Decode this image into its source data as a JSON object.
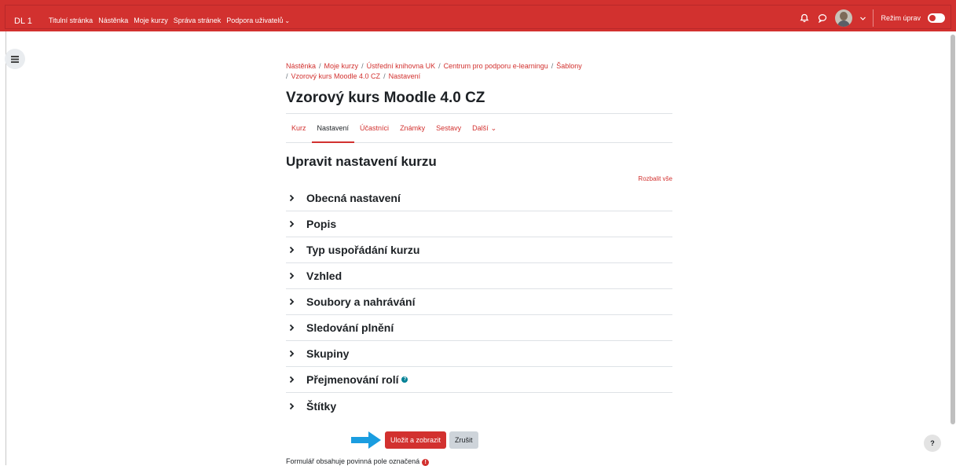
{
  "topbar": {
    "brand": "DL 1",
    "nav": [
      "Titulní stránka",
      "Nástěnka",
      "Moje kurzy",
      "Správa stránek",
      "Podpora uživatelů"
    ],
    "edit_mode_label": "Režim úprav",
    "icons": [
      "bell-icon",
      "chat-icon",
      "user-avatar",
      "chevron-down-icon",
      "toggle-switch"
    ]
  },
  "breadcrumb": [
    "Nástěnka",
    "Moje kurzy",
    "Ústřední knihovna UK",
    "Centrum pro podporu e-learningu",
    "Šablony",
    "Vzorový kurs Moodle 4.0 CZ",
    "Nastavení"
  ],
  "page_title": "Vzorový kurs Moodle 4.0 CZ",
  "tabs": [
    {
      "label": "Kurz"
    },
    {
      "label": "Nastavení",
      "active": true
    },
    {
      "label": "Účastníci"
    },
    {
      "label": "Známky"
    },
    {
      "label": "Sestavy"
    },
    {
      "label": "Další"
    }
  ],
  "section_title": "Upravit nastavení kurzu",
  "expand_all": "Rozbalit vše",
  "fieldsets": [
    "Obecná nastavení",
    "Popis",
    "Typ uspořádání kurzu",
    "Vzhled",
    "Soubory a nahrávání",
    "Sledování plnění",
    "Skupiny",
    "Přejmenování rolí",
    "Štítky"
  ],
  "buttons": {
    "save": "Uložit a zobrazit",
    "cancel": "Zrušit"
  },
  "required_note": "Formulář obsahuje povinná pole označená",
  "help_fab": "?",
  "colors": {
    "brand": "#d2312f",
    "arrow": "#1a9de0",
    "info": "#008196"
  }
}
